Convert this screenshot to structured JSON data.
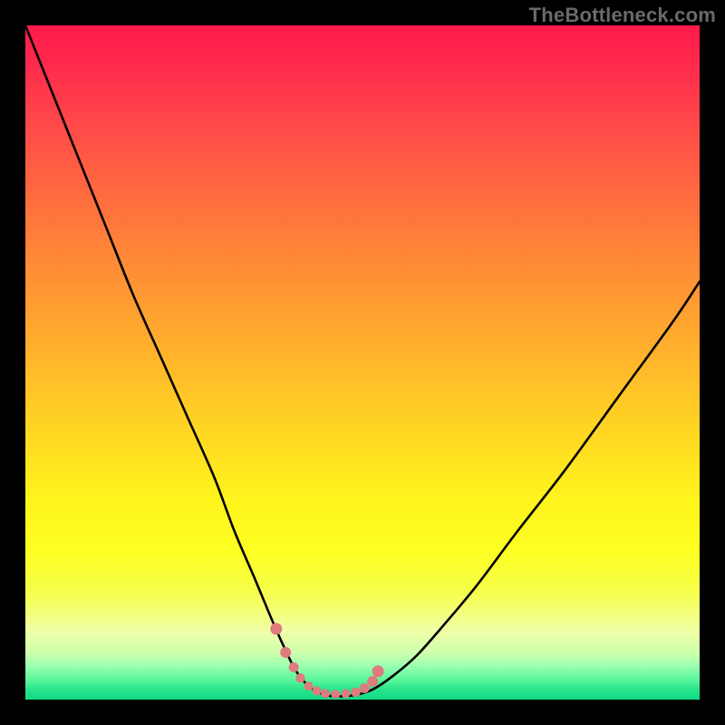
{
  "watermark": "TheBottleneck.com",
  "colors": {
    "background": "#000000",
    "curve_stroke": "#000000",
    "marker_fill": "#dd7b7e",
    "gradient_top": "#ff1a4b",
    "gradient_bottom": "#0fd987"
  },
  "chart_data": {
    "type": "line",
    "title": "",
    "xlabel": "",
    "ylabel": "",
    "xlim": [
      0,
      100
    ],
    "ylim": [
      0,
      100
    ],
    "grid": false,
    "series": [
      {
        "name": "bottleneck-curve",
        "x": [
          0,
          4,
          8,
          12,
          16,
          20,
          24,
          28,
          31,
          34,
          36.5,
          38.5,
          40,
          41.5,
          43,
          45,
          47,
          49,
          51.5,
          54.5,
          58,
          62,
          67,
          73,
          80,
          88,
          96,
          100
        ],
        "y": [
          100,
          90,
          80,
          70,
          60,
          51,
          42,
          33,
          25,
          18,
          12,
          7.5,
          4.5,
          2.5,
          1.3,
          0.6,
          0.5,
          0.7,
          1.5,
          3.5,
          6.5,
          11,
          17,
          25,
          34,
          45,
          56,
          62
        ]
      }
    ],
    "markers": {
      "name": "optimal-range-dots",
      "x": [
        37.2,
        38.6,
        39.8,
        40.8,
        42.0,
        43.2,
        44.5,
        46.0,
        47.5,
        49.0,
        50.3,
        51.5,
        52.3
      ],
      "y": [
        10.5,
        7.0,
        4.8,
        3.2,
        2.0,
        1.3,
        0.9,
        0.8,
        0.9,
        1.1,
        1.7,
        2.7,
        4.2
      ],
      "radius": [
        6.5,
        6.0,
        5.5,
        5.2,
        5.0,
        5.0,
        5.0,
        5.0,
        5.0,
        5.2,
        5.5,
        6.0,
        6.5
      ]
    }
  }
}
